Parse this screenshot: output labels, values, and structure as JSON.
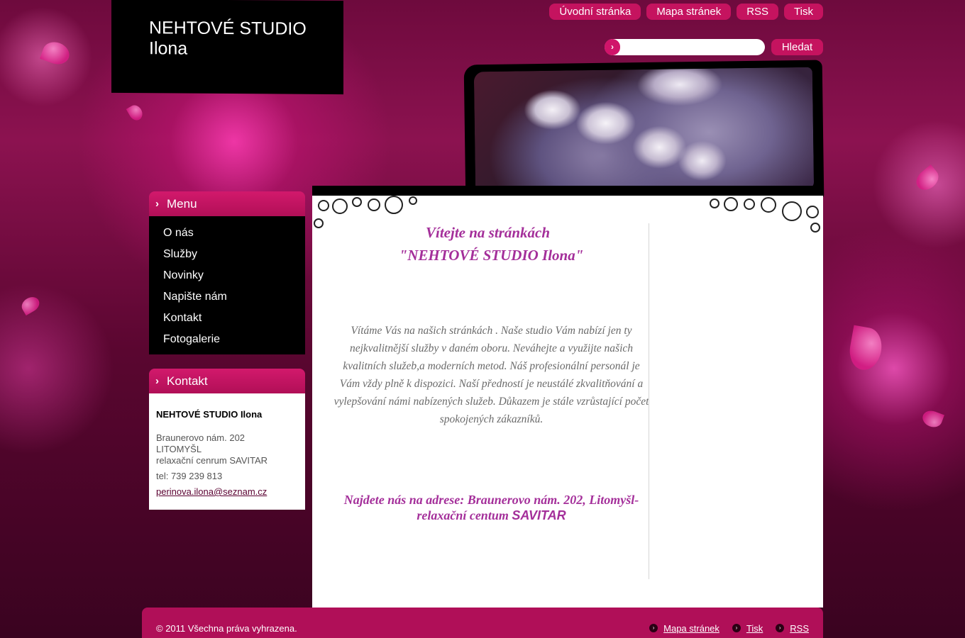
{
  "site": {
    "title_line1": "NEHTOVÉ STUDIO",
    "title_line2": "Ilona"
  },
  "topnav": {
    "items": [
      "Úvodní stránka",
      "Mapa stránek",
      "RSS",
      "Tisk"
    ]
  },
  "search": {
    "value": "",
    "button_label": "Hledat"
  },
  "menu": {
    "title": "Menu",
    "items": [
      "O nás",
      "Služby",
      "Novinky",
      "Napište nám",
      "Kontakt",
      "Fotogalerie"
    ]
  },
  "contact": {
    "title": "Kontakt",
    "name": "NEHTOVÉ STUDIO Ilona",
    "address1": "Braunerovo nám. 202",
    "address2": "LITOMYŠL",
    "address3": "relaxační cenrum SAVITAR",
    "tel": "tel: 739 239 813",
    "email": "perinova.ilona@seznam.cz"
  },
  "main": {
    "welcome_line1": "Vítejte na stránkách",
    "welcome_line2": "\"NEHTOVÉ STUDIO Ilona\"",
    "intro": "Vítáme Vás na našich stránkách . Naše studio Vám nabízí jen ty nejkvalitnější služby v daném oboru. Neváhejte a využijte našich kvalitních služeb,a moderních metod. Náš profesionální personál je Vám vždy plně k dispozici. Naší předností je neustálé zkvalitňování a vylepšování námi nabízených služeb. Důkazem je stále vzrůstající počet spokojených zákazníků.",
    "address_text": "Najdete nás na adrese: Braunerovo nám. 202, Litomyšl-relaxační centum",
    "address_strong": "SAVITAR"
  },
  "footer": {
    "copyright": "© 2011 Všechna práva vyhrazena.",
    "links": [
      "Mapa stránek",
      "Tisk",
      "RSS"
    ]
  },
  "colors": {
    "accent": "#c5135f",
    "heading": "#a42f9a",
    "footer": "#b00f58"
  }
}
